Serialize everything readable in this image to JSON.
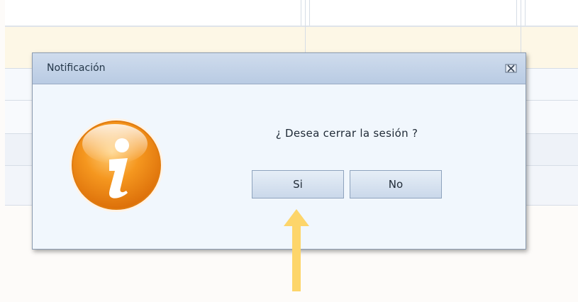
{
  "dialog": {
    "title": "Notificación",
    "message": "¿ Desea cerrar la sesión ?",
    "buttons": {
      "yes_label": "Si",
      "no_label": "No"
    }
  },
  "icons": {
    "info": "info-icon",
    "close": "close-icon",
    "annotation": "arrow-up-icon"
  },
  "colors": {
    "titlebar": "#c3d3e8",
    "dialog_body": "#f1f7fd",
    "button_face": "#d5e1ef",
    "info_icon_orange": "#f28c1f",
    "annotation_arrow": "#fdd56a",
    "highlight_row": "#fdf7e6"
  }
}
